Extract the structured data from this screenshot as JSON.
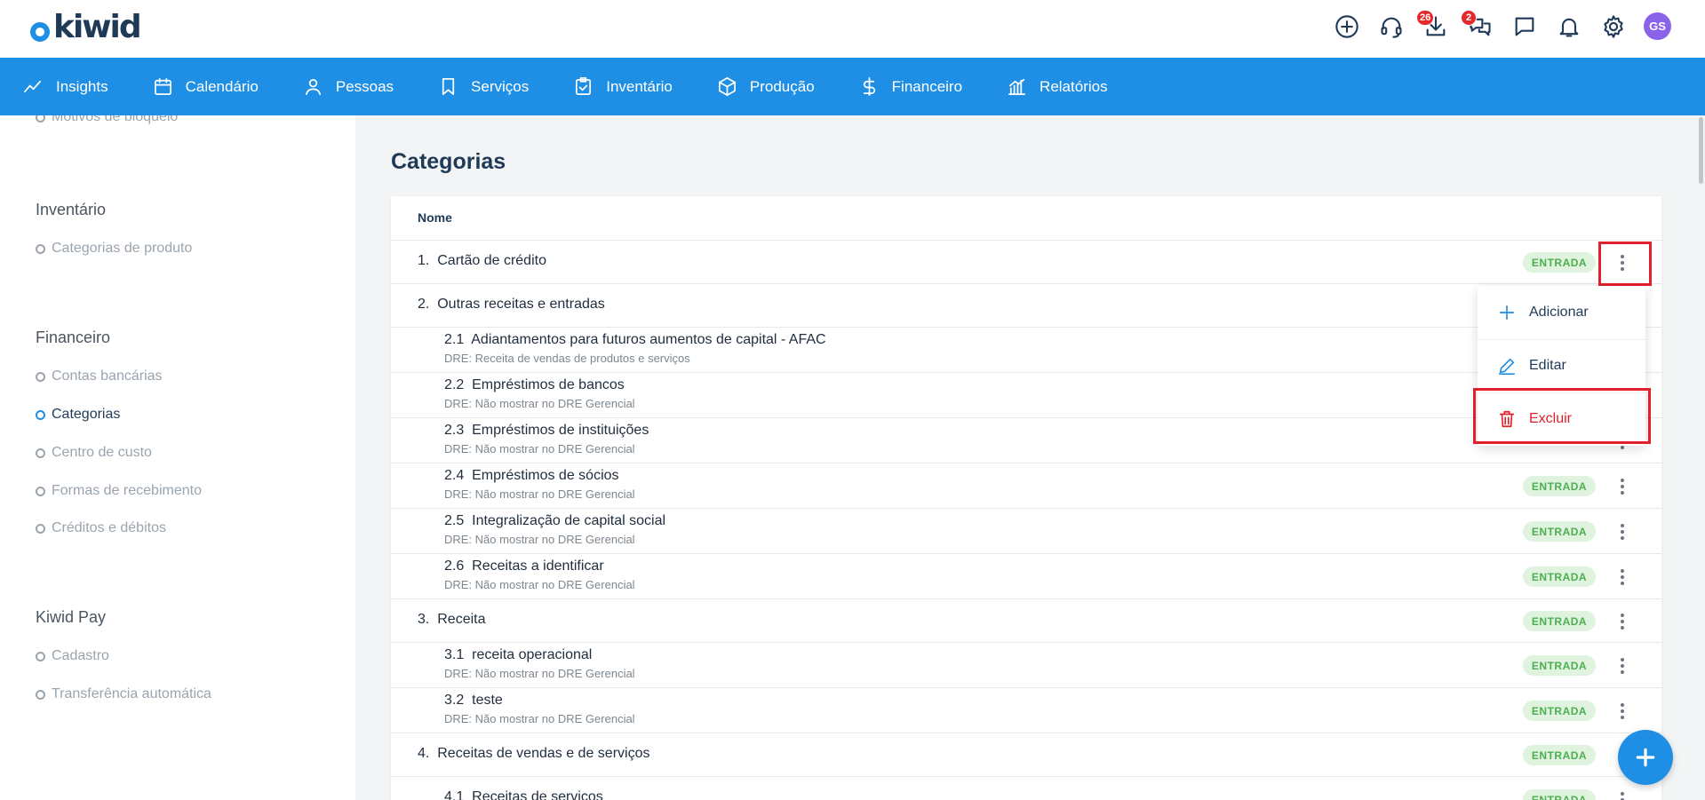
{
  "app": {
    "logo_text": "kiwid"
  },
  "topbar": {
    "icons": [
      {
        "name": "add-circle-icon"
      },
      {
        "name": "support-headset-icon"
      },
      {
        "name": "download-icon",
        "badge": "26"
      },
      {
        "name": "chat-bubbles-icon",
        "badge": "2"
      },
      {
        "name": "message-icon"
      },
      {
        "name": "bell-icon"
      },
      {
        "name": "gear-icon"
      }
    ],
    "avatar_initials": "GS"
  },
  "nav": {
    "items": [
      {
        "label": "Insights",
        "icon": "trend-line-icon"
      },
      {
        "label": "Calendário",
        "icon": "calendar-icon"
      },
      {
        "label": "Pessoas",
        "icon": "person-icon"
      },
      {
        "label": "Serviços",
        "icon": "bookmark-icon"
      },
      {
        "label": "Inventário",
        "icon": "clipboard-icon"
      },
      {
        "label": "Produção",
        "icon": "box-icon"
      },
      {
        "label": "Financeiro",
        "icon": "dollar-icon"
      },
      {
        "label": "Relatórios",
        "icon": "report-chart-icon"
      }
    ]
  },
  "sidebar": {
    "partial_item": "Motivos de bloqueio",
    "sections": [
      {
        "heading": "Inventário",
        "items": [
          "Categorias de produto"
        ]
      },
      {
        "heading": "Financeiro",
        "items": [
          "Contas bancárias",
          "Categorias",
          "Centro de custo",
          "Formas de recebimento",
          "Créditos e débitos"
        ],
        "active": "Categorias"
      },
      {
        "heading": "Kiwid Pay",
        "items": [
          "Cadastro",
          "Transferência automática"
        ]
      }
    ]
  },
  "main": {
    "title": "Categorias",
    "column_header": "Nome",
    "pill_label": "ENTRADA",
    "rows": [
      {
        "code": "1.",
        "name": "Cartão de crédito",
        "sub": "",
        "pill": "ENTRADA"
      },
      {
        "code": "2.",
        "name": "Outras receitas e entradas",
        "sub": "",
        "pill": ""
      },
      {
        "code": "2.1",
        "name": "Adiantamentos para futuros aumentos de capital - AFAC",
        "sub": "DRE: Receita de vendas de produtos e serviços",
        "pill": ""
      },
      {
        "code": "2.2",
        "name": "Empréstimos de bancos",
        "sub": "DRE: Não mostrar no DRE Gerencial",
        "pill": ""
      },
      {
        "code": "2.3",
        "name": "Empréstimos de instituições",
        "sub": "DRE: Não mostrar no DRE Gerencial",
        "pill": ""
      },
      {
        "code": "2.4",
        "name": "Empréstimos de sócios",
        "sub": "DRE: Não mostrar no DRE Gerencial",
        "pill": "ENTRADA"
      },
      {
        "code": "2.5",
        "name": "Integralização de capital social",
        "sub": "DRE: Não mostrar no DRE Gerencial",
        "pill": "ENTRADA"
      },
      {
        "code": "2.6",
        "name": "Receitas a identificar",
        "sub": "DRE: Não mostrar no DRE Gerencial",
        "pill": "ENTRADA"
      },
      {
        "code": "3.",
        "name": "Receita",
        "sub": "",
        "pill": "ENTRADA"
      },
      {
        "code": "3.1",
        "name": "receita operacional",
        "sub": "DRE: Não mostrar no DRE Gerencial",
        "pill": "ENTRADA"
      },
      {
        "code": "3.2",
        "name": "teste",
        "sub": "DRE: Não mostrar no DRE Gerencial",
        "pill": "ENTRADA"
      },
      {
        "code": "4.",
        "name": "Receitas de vendas e de serviços",
        "sub": "",
        "pill": "ENTRADA"
      },
      {
        "code": "4.1",
        "name": "Receitas de serviços",
        "sub": "",
        "pill": "ENTRADA"
      }
    ]
  },
  "menu": {
    "items": [
      {
        "label": "Adicionar",
        "icon": "plus-icon"
      },
      {
        "label": "Editar",
        "icon": "pencil-icon"
      },
      {
        "label": "Excluir",
        "icon": "trash-icon"
      }
    ]
  },
  "colors": {
    "primary": "#1f8fe5",
    "navy": "#1f3a57",
    "danger": "#e0202a",
    "pill_bg": "#e0f3de",
    "pill_text": "#4caf50"
  }
}
